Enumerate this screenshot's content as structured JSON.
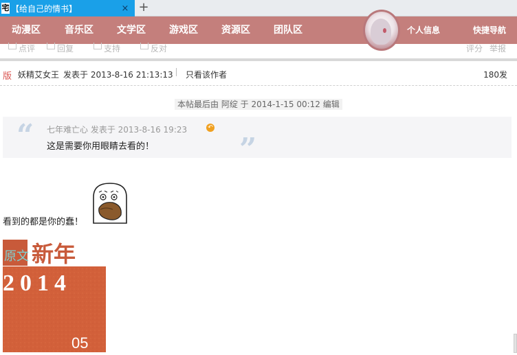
{
  "browser": {
    "tab_favicon": "宅",
    "tab_title": "【给自己的情书】",
    "tab_close": "×",
    "new_tab": "+"
  },
  "nav": {
    "items": [
      "动漫区",
      "音乐区",
      "文学区",
      "游戏区",
      "资源区",
      "团队区"
    ],
    "profile": "个人信息",
    "quick_nav": "快捷导航"
  },
  "actions": {
    "items": [
      "点评",
      "回复",
      "支持",
      "反对"
    ],
    "right": [
      "评分",
      "举报"
    ]
  },
  "post": {
    "badge": "版",
    "author": "妖精艾女王",
    "posted": "发表于 2013-8-16 21:13:13",
    "only_author": "只看该作者",
    "floor": "180发",
    "edit_note": "本帖最后由 阿绽 于 2014-1-15 00:12 编辑",
    "quote": {
      "meta": "七年难亡心 发表于 2013-8-16 19:23",
      "text": "这是需要你用眼睛去看的！"
    },
    "body": "看到的都是你的蠢！",
    "ny_title": "新年",
    "ny_stamp": "原文",
    "ny_year": "2014",
    "ny_day": "05"
  },
  "colors": {
    "tab": "#1aa0e8",
    "nav": "#c47f7c",
    "ny_orange": "#d2603a"
  }
}
